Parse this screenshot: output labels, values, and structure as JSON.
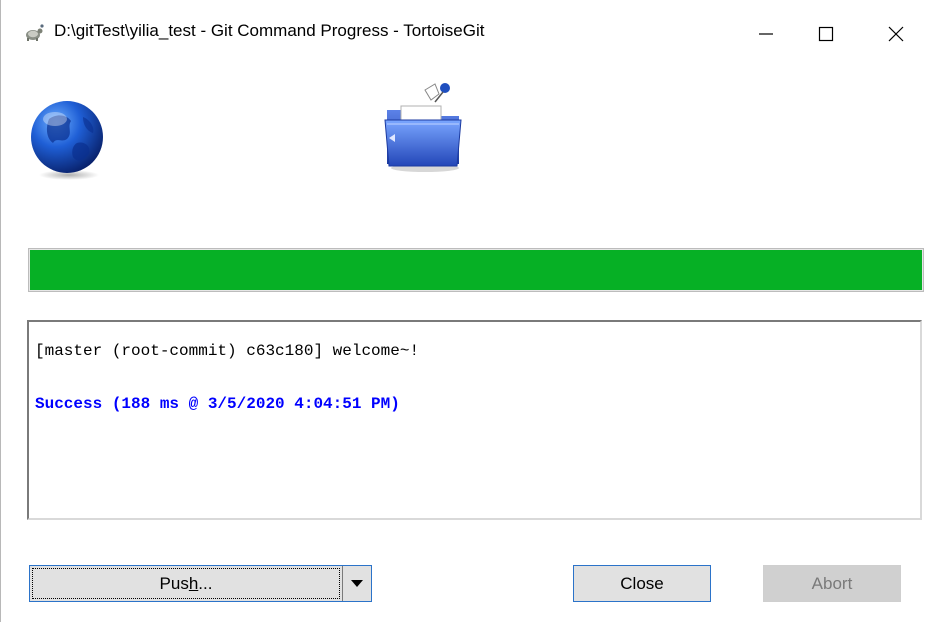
{
  "window": {
    "title": "D:\\gitTest\\yilia_test - Git Command Progress - TortoiseGit",
    "controls": {
      "minimize": "minimize",
      "maximize": "maximize",
      "close": "close"
    }
  },
  "icons": {
    "app": "tortoise-icon",
    "globe": "globe-icon",
    "folder": "folder-icon"
  },
  "progress": {
    "value": 1.0,
    "color": "#06b025"
  },
  "log": {
    "lines": [
      {
        "text": "[master (root-commit) c63c180] welcome~!",
        "color": "#000000"
      },
      {
        "text": "Success (188 ms @ 3/5/2020 4:04:51 PM)",
        "color": "#0000ff"
      }
    ]
  },
  "buttons": {
    "push_prefix": "Pus",
    "push_mnemonic": "h",
    "push_suffix": "...",
    "close": "Close",
    "abort": "Abort"
  }
}
